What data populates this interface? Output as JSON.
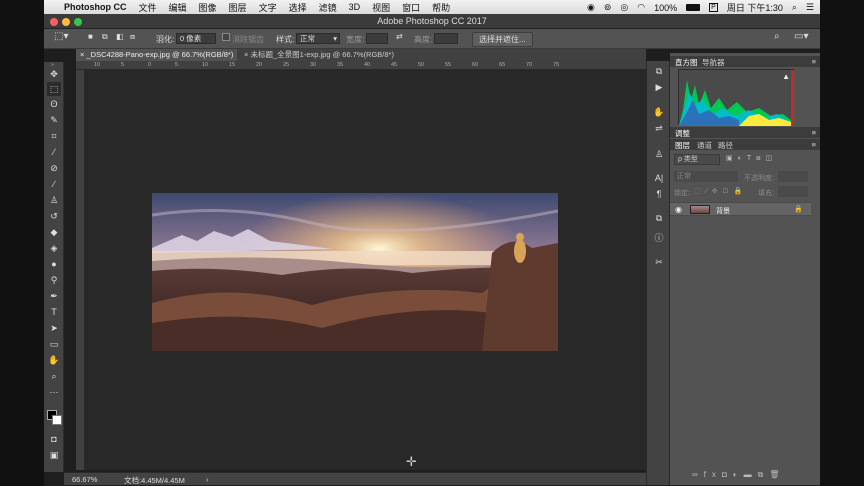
{
  "menubar": {
    "app_name": "Photoshop CC",
    "items": [
      "文件",
      "编辑",
      "图像",
      "图层",
      "文字",
      "选择",
      "滤镜",
      "3D",
      "视图",
      "窗口",
      "帮助"
    ],
    "battery": "100%",
    "clock": "周日 下午1:30"
  },
  "window": {
    "title": "Adobe Photoshop CC 2017"
  },
  "options": {
    "feather_label": "羽化:",
    "feather_value": "0 像素",
    "antialias_label": "消除锯齿",
    "style_label": "样式:",
    "style_value": "正常",
    "width_label": "宽度:",
    "height_label": "高度:",
    "select_mask_button": "选择并遮住..."
  },
  "tabs": [
    {
      "label": "_DSC4288-Pano-exp.jpg @ 66.7%(RGB/8*)",
      "active": true
    },
    {
      "label": "未标题_全景图1-exp.jpg @ 66.7%(RGB/8*)",
      "active": false
    }
  ],
  "ruler": {
    "ticks": [
      "10",
      "5",
      "0",
      "5",
      "10",
      "15",
      "20",
      "25",
      "30",
      "35",
      "40",
      "45",
      "50",
      "55",
      "60",
      "65",
      "70",
      "75"
    ]
  },
  "status": {
    "zoom": "66.67%",
    "doc": "文档:4.45M/4.45M"
  },
  "panels": {
    "histogram_tabs": [
      "直方图",
      "导航器"
    ],
    "adjust_tab": "调整",
    "layers_tabs": [
      "图层",
      "通道",
      "路径"
    ],
    "kind_label": "ρ 类型",
    "blend_mode": "正常",
    "opacity_label": "不透明度:",
    "lock_label": "锁定:",
    "fill_label": "填充:",
    "layer_name": "背景"
  },
  "colors": {
    "accent": "#2f6fd8",
    "panel": "#535353",
    "canvas": "#282828"
  }
}
